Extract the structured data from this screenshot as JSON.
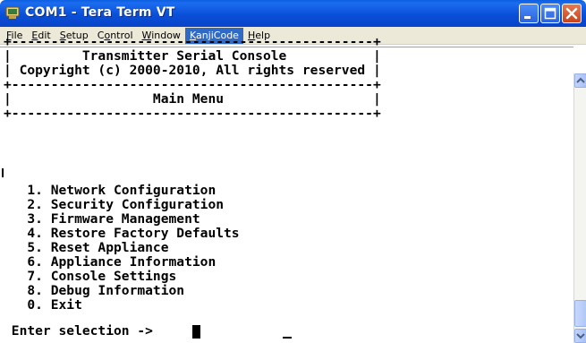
{
  "window": {
    "title": "COM1 - Tera Term VT"
  },
  "menubar": {
    "items": [
      {
        "mnemonic": "F",
        "rest": "ile"
      },
      {
        "mnemonic": "E",
        "rest": "dit"
      },
      {
        "mnemonic": "S",
        "rest": "etup"
      },
      {
        "pre": "C",
        "mnemonic": "o",
        "rest": "ntrol"
      },
      {
        "mnemonic": "W",
        "rest": "indow"
      },
      {
        "mnemonic": "K",
        "rest": "anjiCode"
      },
      {
        "mnemonic": "H",
        "rest": "elp"
      }
    ]
  },
  "terminal": {
    "header_lines": [
      "+----------------------------------------------+",
      "|         Transmitter Serial Console           |",
      "| Copyright (c) 2000-2010, All rights reserved |",
      "+----------------------------------------------+",
      "|                  Main Menu                   |",
      "+----------------------------------------------+"
    ],
    "menu_items": [
      "   1. Network Configuration",
      "   2. Security Configuration",
      "   3. Firmware Management",
      "   4. Restore Factory Defaults",
      "   5. Reset Appliance",
      "   6. Appliance Information",
      "   7. Console Settings",
      "   8. Debug Information",
      "   0. Exit"
    ],
    "prompt": " Enter selection -> "
  },
  "icons": {
    "app": "tera-term-icon",
    "minimize": "minimize-icon",
    "maximize": "maximize-icon",
    "close": "close-icon",
    "scroll_up": "scroll-up-arrow-icon",
    "scroll_down": "scroll-down-arrow-icon"
  },
  "colors": {
    "titlebar": "#0a4fd8",
    "menubar": "#ece9d8",
    "menu_active": "#316ac5",
    "close_button": "#c8441a"
  }
}
